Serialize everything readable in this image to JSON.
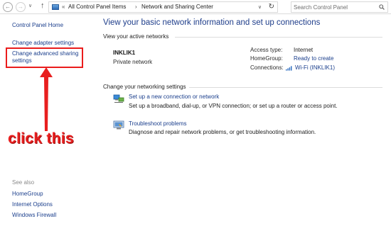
{
  "address_bar": {
    "back_glyph": "←",
    "forward_glyph": "→",
    "recent_glyph": "∨",
    "up_glyph": "↑",
    "crumb_sep_1": "«",
    "crumb_1": "All Control Panel Items",
    "crumb_sep_2": "›",
    "crumb_2": "Network and Sharing Center",
    "dropdown_glyph": "∨",
    "refresh_glyph": "↻"
  },
  "search": {
    "placeholder": "Search Control Panel"
  },
  "sidebar": {
    "home": "Control Panel Home",
    "adapter": "Change adapter settings",
    "advanced_line1": "Change advanced sharing",
    "advanced_line2": "settings",
    "see_also": "See also",
    "see_also_items": [
      "HomeGroup",
      "Internet Options",
      "Windows Firewall"
    ]
  },
  "annotation": {
    "callout": "click this",
    "color": "#e81f1f"
  },
  "main": {
    "title": "View your basic network information and set up connections",
    "active_networks_label": "View your active networks",
    "network": {
      "name": "INKLIK1",
      "type": "Private network",
      "access_type_label": "Access type:",
      "access_type_value": "Internet",
      "homegroup_label": "HomeGroup:",
      "homegroup_value": "Ready to create",
      "connections_label": "Connections:",
      "connections_value": "Wi-Fi (INKLIK1)"
    },
    "settings_label": "Change your networking settings",
    "settings": [
      {
        "icon": "network-setup-icon",
        "link": "Set up a new connection or network",
        "desc": "Set up a broadband, dial-up, or VPN connection; or set up a router or access point."
      },
      {
        "icon": "troubleshoot-icon",
        "link": "Troubleshoot problems",
        "desc": "Diagnose and repair network problems, or get troubleshooting information."
      }
    ]
  },
  "colors": {
    "link": "#1a3e8c",
    "title": "#1e3d8a",
    "highlight": "#ea1c1c"
  }
}
